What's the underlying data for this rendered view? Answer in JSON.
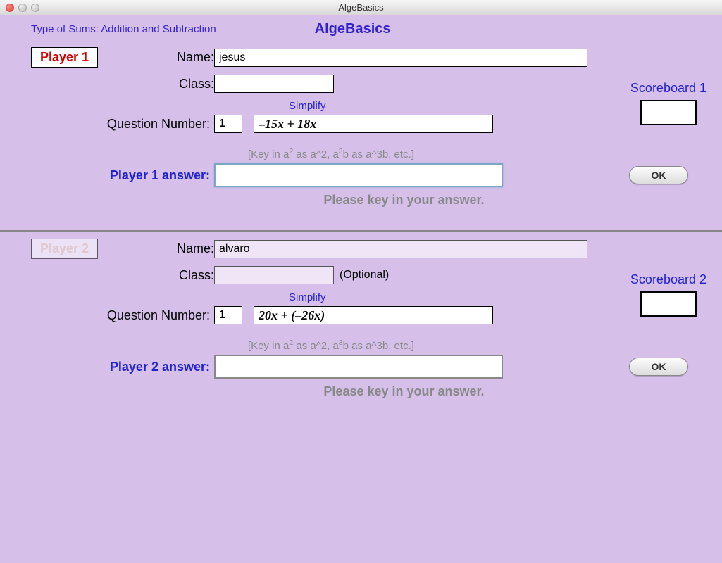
{
  "window": {
    "title": "AlgeBasics"
  },
  "header": {
    "type_of_sums": "Type of Sums: Addition and Subtraction",
    "app_title": "AlgeBasics"
  },
  "labels": {
    "name": "Name:",
    "class": "Class:",
    "question_number": "Question Number:",
    "simplify": "Simplify",
    "hint_prefix": "[Key in a",
    "hint_mid": " as a^2, a",
    "hint_suffix": "b as a^3b, etc.]",
    "answer_prompt": "Please key in your answer.",
    "optional": "(Optional)",
    "ok": "OK"
  },
  "player1": {
    "badge": "Player 1",
    "name": "jesus",
    "class": "",
    "question_number": "1",
    "question": "–15x + 18x",
    "answer_label": "Player 1 answer:",
    "answer": "",
    "scoreboard_label": "Scoreboard 1",
    "score": ""
  },
  "player2": {
    "badge": "Player 2",
    "name": "alvaro",
    "class": "",
    "question_number": "1",
    "question": "20x + (–26x)",
    "answer_label": "Player 2 answer:",
    "answer": "",
    "scoreboard_label": "Scoreboard 2",
    "score": ""
  }
}
